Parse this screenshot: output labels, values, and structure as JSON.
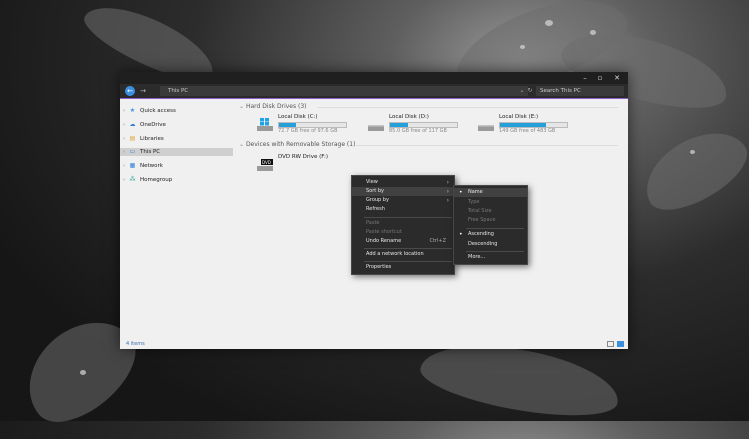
{
  "window": {
    "address": "This PC",
    "search_placeholder": "Search This PC",
    "buttons": {
      "minimize": "–",
      "maximize": "▫",
      "close": "✕",
      "back": "←",
      "forward": "→"
    }
  },
  "sidebar": {
    "items": [
      {
        "label": "Quick access",
        "icon": "star-icon",
        "selected": false
      },
      {
        "label": "OneDrive",
        "icon": "cloud-icon",
        "selected": false
      },
      {
        "label": "Libraries",
        "icon": "library-icon",
        "selected": false
      },
      {
        "label": "This PC",
        "icon": "computer-icon",
        "selected": true
      },
      {
        "label": "Network",
        "icon": "network-icon",
        "selected": false
      },
      {
        "label": "Homegroup",
        "icon": "homegroup-icon",
        "selected": false
      }
    ]
  },
  "content": {
    "groups": [
      {
        "header": "Hard Disk Drives (3)"
      },
      {
        "header": "Devices with Removable Storage (1)"
      }
    ],
    "drives": [
      {
        "name": "Local Disk (C:)",
        "free": "72.7 GB free of 97.6 GB",
        "used_fraction": 0.26
      },
      {
        "name": "Local Disk (D:)",
        "free": "85.0 GB free of 117 GB",
        "used_fraction": 0.27
      },
      {
        "name": "Local Disk (E:)",
        "free": "149 GB free of 483 GB",
        "used_fraction": 0.69
      }
    ],
    "dvd": {
      "name": "DVD RW Drive (F:)",
      "badge": "DVD"
    }
  },
  "status": {
    "items": "4 items"
  },
  "context_menu": {
    "items": [
      {
        "label": "View",
        "submenu": true
      },
      {
        "label": "Sort by",
        "submenu": true
      },
      {
        "label": "Group by",
        "submenu": true
      },
      {
        "label": "Refresh"
      },
      {
        "label": "Paste",
        "disabled": true
      },
      {
        "label": "Paste shortcut",
        "disabled": true
      },
      {
        "label": "Undo Rename",
        "shortcut": "Ctrl+Z"
      },
      {
        "label": "Add a network location"
      },
      {
        "label": "Properties"
      }
    ]
  },
  "sort_submenu": {
    "items": [
      {
        "label": "Name",
        "checked": true
      },
      {
        "label": "Type",
        "disabled": true
      },
      {
        "label": "Total Size",
        "disabled": true
      },
      {
        "label": "Free Space",
        "disabled": true
      },
      {
        "label": "Ascending",
        "checked": true
      },
      {
        "label": "Descending"
      },
      {
        "label": "More..."
      }
    ]
  },
  "colors": {
    "accent": "#8a5cc9",
    "drive_bar": "#26a0da",
    "selection": "#cfcfcf"
  }
}
